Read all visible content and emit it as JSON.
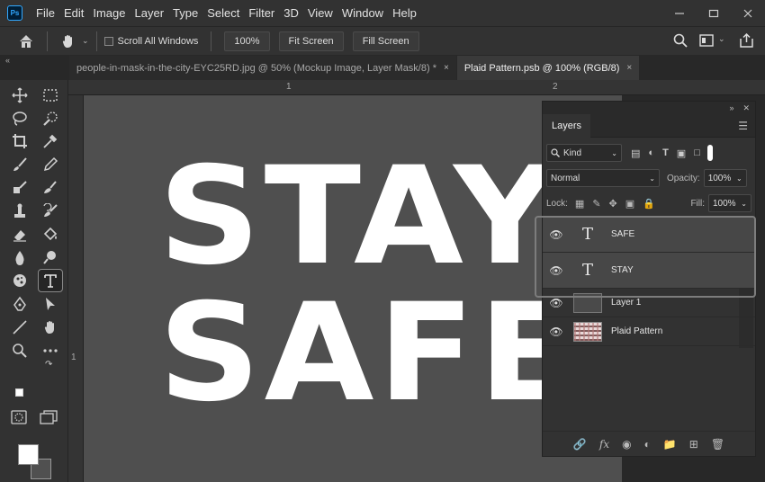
{
  "menubar": {
    "logo": "Ps",
    "items": [
      "File",
      "Edit",
      "Image",
      "Layer",
      "Type",
      "Select",
      "Filter",
      "3D",
      "View",
      "Window",
      "Help"
    ],
    "window_controls": [
      "minimize-icon",
      "restore-icon",
      "close-icon"
    ]
  },
  "options": {
    "scroll_all_windows": "Scroll All Windows",
    "zoom": "100%",
    "fit_screen": "Fit Screen",
    "fill_screen": "Fill Screen"
  },
  "tabs": [
    {
      "label": "people-in-mask-in-the-city-EYC25RD.jpg @ 50% (Mockup Image, Layer Mask/8) *",
      "close": "×",
      "active": false
    },
    {
      "label": "Plaid Pattern.psb @ 100% (RGB/8)",
      "close": "×",
      "active": true
    }
  ],
  "rulers": {
    "top": [
      "1",
      "2"
    ],
    "left": [
      "1"
    ]
  },
  "canvas": {
    "line1": "STAY",
    "line2": "SAFE",
    "text_color": "#ffffff",
    "bg_color": "#4f4f4f"
  },
  "layers_panel": {
    "tab_label": "Layers",
    "filter_kind": "Kind",
    "blend_mode": "Normal",
    "opacity_label": "Opacity:",
    "opacity_value": "100%",
    "lock_label": "Lock:",
    "fill_label": "Fill:",
    "fill_value": "100%",
    "layers": [
      {
        "name": "SAFE",
        "kind": "type",
        "selected": true
      },
      {
        "name": "STAY",
        "kind": "type",
        "selected": true
      },
      {
        "name": "Layer 1",
        "kind": "pixel",
        "selected": false
      },
      {
        "name": "Plaid Pattern",
        "kind": "pattern",
        "selected": false
      }
    ],
    "type_thumb_glyph": "T"
  },
  "colors": {
    "foreground": "#ffffff",
    "background": "#505050",
    "accent": "#31a8ff"
  }
}
